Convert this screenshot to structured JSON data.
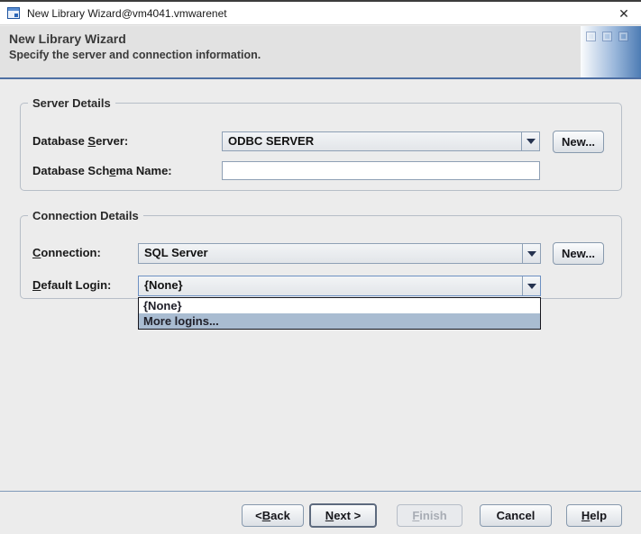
{
  "window": {
    "title": "New Library Wizard@vm4041.vmwarenet",
    "close_glyph": "✕"
  },
  "header": {
    "title": "New Library Wizard",
    "subtitle": "Specify the server and connection information."
  },
  "server_details": {
    "legend": "Server Details",
    "server_label": {
      "pre": "Database ",
      "mn": "S",
      "post": "erver:"
    },
    "server_value": "ODBC SERVER",
    "server_new_label": "New...",
    "schema_label": {
      "pre": "Database Sch",
      "mn": "e",
      "post": "ma Name:"
    },
    "schema_value": ""
  },
  "connection_details": {
    "legend": "Connection Details",
    "connection_label": {
      "pre": "",
      "mn": "C",
      "post": "onnection:"
    },
    "connection_value": "SQL Server",
    "connection_new_label": "New...",
    "login_label": {
      "pre": "",
      "mn": "D",
      "post": "efault Login:"
    },
    "login_value": "{None}",
    "login_options": [
      {
        "label": "{None}",
        "selected": false
      },
      {
        "label": "More logins...",
        "selected": true
      }
    ]
  },
  "buttons": {
    "back": {
      "pre": "< ",
      "mn": "B",
      "post": "ack"
    },
    "next": {
      "pre": "",
      "mn": "N",
      "post": "ext >"
    },
    "finish": {
      "pre": "",
      "mn": "F",
      "post": "inish"
    },
    "cancel": {
      "pre": "",
      "mn": "",
      "post": "Cancel"
    },
    "help": {
      "pre": "",
      "mn": "H",
      "post": "elp"
    }
  },
  "colors": {
    "header_separator": "#4e6fa3",
    "selection_highlight": "#a9bcd1",
    "accent_gradient_blue": "#4d7cb4"
  }
}
